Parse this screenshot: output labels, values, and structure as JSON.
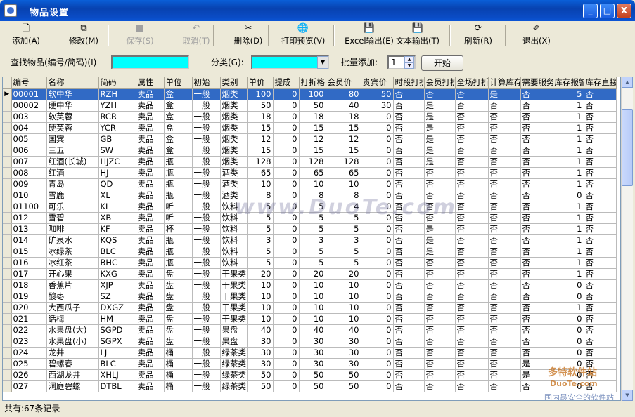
{
  "window": {
    "title": "物品设置",
    "controls": {
      "minimize": "_",
      "maximize": "□",
      "close": "X"
    }
  },
  "toolbar": [
    {
      "label": "添加(A)",
      "icon": "new-document-icon",
      "icon_glyph": "🗋",
      "enabled": true
    },
    {
      "label": "修改(M)",
      "icon": "copy-icon",
      "icon_glyph": "⧉",
      "enabled": true
    },
    {
      "label": "保存(S)",
      "icon": "save-icon",
      "icon_glyph": "■",
      "enabled": false
    },
    {
      "label": "取消(T)",
      "icon": "undo-icon",
      "icon_glyph": "↶",
      "enabled": false
    },
    {
      "label": "删除(D)",
      "icon": "scissors-icon",
      "icon_glyph": "✂",
      "enabled": true
    },
    {
      "label": "打印预览(V)",
      "icon": "print-preview-icon",
      "icon_glyph": "🌐",
      "enabled": true
    },
    {
      "label": "Excel输出(E)",
      "icon": "floppy-disk-icon",
      "icon_glyph": "💾",
      "enabled": true
    },
    {
      "label": "文本输出(T)",
      "icon": "floppy-disk-icon",
      "icon_glyph": "💾",
      "enabled": true
    },
    {
      "label": "刷新(R)",
      "icon": "refresh-icon",
      "icon_glyph": "⟳",
      "enabled": true
    },
    {
      "label": "退出(X)",
      "icon": "broom-exit-icon",
      "icon_glyph": "✐",
      "enabled": true
    }
  ],
  "search": {
    "find_label": "查找物品(编号/简码)(I)",
    "find_value": "",
    "category_label": "分类(G):",
    "category_value": "",
    "batch_label": "批量添加:",
    "batch_value": "1",
    "start_button": "开始"
  },
  "grid": {
    "columns": [
      "编号",
      "名称",
      "简码",
      "属性",
      "单位",
      "初始",
      "类别",
      "单价",
      "提成",
      "打折格",
      "会员价",
      "贵宾价",
      "时段打折",
      "会员打折",
      "全场打折",
      "计算库存",
      "需要服务",
      "库存报警",
      "库存直接"
    ],
    "rows": [
      [
        "00001",
        "软中华",
        "RZH",
        "卖品",
        "盒",
        "一般",
        "烟类",
        "100",
        "0",
        "100",
        "80",
        "50",
        "否",
        "否",
        "否",
        "是",
        "否",
        "5",
        "否"
      ],
      [
        "00002",
        "硬中华",
        "YZH",
        "卖品",
        "盒",
        "一般",
        "烟类",
        "50",
        "0",
        "50",
        "40",
        "30",
        "否",
        "是",
        "否",
        "否",
        "否",
        "1",
        "否"
      ],
      [
        "003",
        "软芙蓉",
        "RCR",
        "卖品",
        "盒",
        "一般",
        "烟类",
        "18",
        "0",
        "18",
        "18",
        "0",
        "否",
        "是",
        "否",
        "否",
        "否",
        "1",
        "否"
      ],
      [
        "004",
        "硬芙蓉",
        "YCR",
        "卖品",
        "盒",
        "一般",
        "烟类",
        "15",
        "0",
        "15",
        "15",
        "0",
        "否",
        "是",
        "否",
        "否",
        "否",
        "1",
        "否"
      ],
      [
        "005",
        "国宾",
        "GB",
        "卖品",
        "盒",
        "一般",
        "烟类",
        "12",
        "0",
        "12",
        "12",
        "0",
        "否",
        "是",
        "否",
        "否",
        "否",
        "1",
        "否"
      ],
      [
        "006",
        "三五",
        "SW",
        "卖品",
        "盒",
        "一般",
        "烟类",
        "15",
        "0",
        "15",
        "15",
        "0",
        "否",
        "是",
        "否",
        "否",
        "否",
        "1",
        "否"
      ],
      [
        "007",
        "红酒(长城)",
        "HJZC",
        "卖品",
        "瓶",
        "一般",
        "烟类",
        "128",
        "0",
        "128",
        "128",
        "0",
        "否",
        "是",
        "否",
        "否",
        "否",
        "1",
        "否"
      ],
      [
        "008",
        "红酒",
        "HJ",
        "卖品",
        "瓶",
        "一般",
        "酒类",
        "65",
        "0",
        "65",
        "65",
        "0",
        "否",
        "否",
        "否",
        "否",
        "否",
        "1",
        "否"
      ],
      [
        "009",
        "青岛",
        "QD",
        "卖品",
        "瓶",
        "一般",
        "酒类",
        "10",
        "0",
        "10",
        "10",
        "0",
        "否",
        "否",
        "否",
        "否",
        "否",
        "1",
        "否"
      ],
      [
        "010",
        "雪鹿",
        "XL",
        "卖品",
        "瓶",
        "一般",
        "酒类",
        "8",
        "0",
        "8",
        "8",
        "0",
        "否",
        "否",
        "否",
        "否",
        "否",
        "0",
        "否"
      ],
      [
        "01100",
        "可乐",
        "KL",
        "卖品",
        "听",
        "一般",
        "饮料",
        "5",
        "0",
        "5",
        "4",
        "0",
        "否",
        "否",
        "否",
        "否",
        "否",
        "1",
        "否"
      ],
      [
        "012",
        "雪碧",
        "XB",
        "卖品",
        "听",
        "一般",
        "饮料",
        "5",
        "0",
        "5",
        "5",
        "0",
        "否",
        "否",
        "否",
        "否",
        "否",
        "1",
        "否"
      ],
      [
        "013",
        "咖啡",
        "KF",
        "卖品",
        "杯",
        "一般",
        "饮料",
        "5",
        "0",
        "5",
        "5",
        "0",
        "否",
        "是",
        "否",
        "否",
        "否",
        "1",
        "否"
      ],
      [
        "014",
        "矿泉水",
        "KQS",
        "卖品",
        "瓶",
        "一般",
        "饮料",
        "3",
        "0",
        "3",
        "3",
        "0",
        "否",
        "是",
        "否",
        "否",
        "否",
        "1",
        "否"
      ],
      [
        "015",
        "冰绿茶",
        "BLC",
        "卖品",
        "瓶",
        "一般",
        "饮料",
        "5",
        "0",
        "5",
        "5",
        "0",
        "否",
        "是",
        "否",
        "否",
        "否",
        "1",
        "否"
      ],
      [
        "016",
        "冰红茶",
        "BHC",
        "卖品",
        "瓶",
        "一般",
        "饮料",
        "5",
        "0",
        "5",
        "5",
        "0",
        "否",
        "否",
        "否",
        "否",
        "否",
        "1",
        "否"
      ],
      [
        "017",
        "开心果",
        "KXG",
        "卖品",
        "盘",
        "一般",
        "干果类",
        "20",
        "0",
        "20",
        "20",
        "0",
        "否",
        "否",
        "否",
        "否",
        "否",
        "1",
        "否"
      ],
      [
        "018",
        "香蕉片",
        "XJP",
        "卖品",
        "盘",
        "一般",
        "干果类",
        "10",
        "0",
        "10",
        "10",
        "0",
        "否",
        "否",
        "否",
        "否",
        "否",
        "0",
        "否"
      ],
      [
        "019",
        "酸枣",
        "SZ",
        "卖品",
        "盘",
        "一般",
        "干果类",
        "10",
        "0",
        "10",
        "10",
        "0",
        "否",
        "否",
        "否",
        "否",
        "否",
        "0",
        "否"
      ],
      [
        "020",
        "大西瓜子",
        "DXGZ",
        "卖品",
        "盘",
        "一般",
        "干果类",
        "10",
        "0",
        "10",
        "10",
        "0",
        "否",
        "否",
        "否",
        "否",
        "否",
        "1",
        "否"
      ],
      [
        "021",
        "话梅",
        "HM",
        "卖品",
        "盘",
        "一般",
        "干果类",
        "10",
        "0",
        "10",
        "10",
        "0",
        "否",
        "否",
        "否",
        "否",
        "否",
        "0",
        "否"
      ],
      [
        "022",
        "水果盘(大)",
        "SGPD",
        "卖品",
        "盘",
        "一般",
        "果盘",
        "40",
        "0",
        "40",
        "40",
        "0",
        "否",
        "否",
        "否",
        "否",
        "否",
        "0",
        "否"
      ],
      [
        "023",
        "水果盘(小)",
        "SGPX",
        "卖品",
        "盘",
        "一般",
        "果盘",
        "30",
        "0",
        "30",
        "30",
        "0",
        "否",
        "否",
        "否",
        "否",
        "否",
        "0",
        "否"
      ],
      [
        "024",
        "龙井",
        "LJ",
        "卖品",
        "桶",
        "一般",
        "绿茶类",
        "30",
        "0",
        "30",
        "30",
        "0",
        "否",
        "否",
        "否",
        "否",
        "否",
        "0",
        "否"
      ],
      [
        "025",
        "碧螺春",
        "BLC",
        "卖品",
        "桶",
        "一般",
        "绿茶类",
        "30",
        "0",
        "30",
        "30",
        "0",
        "否",
        "否",
        "否",
        "否",
        "是",
        "0",
        "否"
      ],
      [
        "026",
        "西湖龙井",
        "XHLJ",
        "卖品",
        "桶",
        "一般",
        "绿茶类",
        "50",
        "0",
        "50",
        "50",
        "0",
        "否",
        "否",
        "否",
        "否",
        "是",
        "0",
        "否"
      ],
      [
        "027",
        "洞庭碧螺",
        "DTBL",
        "卖品",
        "桶",
        "一般",
        "绿茶类",
        "50",
        "0",
        "50",
        "50",
        "0",
        "否",
        "否",
        "否",
        "否",
        "否",
        "0",
        "否"
      ]
    ]
  },
  "status": "共有:67条记录",
  "watermark": "www.DuoTe.com",
  "logo_text": "多特软件站",
  "logo_domain": "DuoTe.com",
  "logo_sub": "国内最安全的软件站"
}
